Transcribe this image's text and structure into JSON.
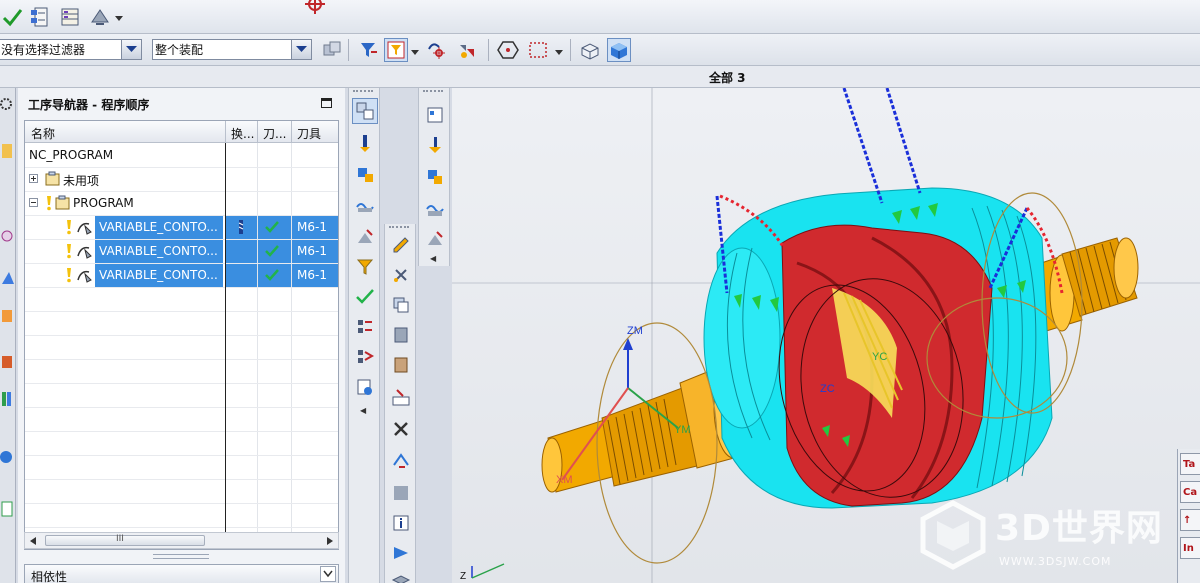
{
  "toolbar": {
    "filter_combo": "没有选择过滤器",
    "scope_combo": "整个装配"
  },
  "status_strip": {
    "text": "全部 3"
  },
  "navigator": {
    "title": "工序导航器 - 程序顺序",
    "columns": [
      "名称",
      "换...",
      "刀...",
      "刀具"
    ],
    "rows": [
      {
        "name": "NC_PROGRAM",
        "tool": ""
      },
      {
        "name": "未用项",
        "tool": ""
      },
      {
        "name": "PROGRAM",
        "tool": ""
      },
      {
        "name": "VARIABLE_CONTO...",
        "tool": "M6-1"
      },
      {
        "name": "VARIABLE_CONTO...",
        "tool": "M6-1"
      },
      {
        "name": "VARIABLE_CONTO...",
        "tool": "M6-1"
      }
    ],
    "scroll_glyph": "III",
    "dependencies_label": "相依性"
  },
  "viewport": {
    "wcs_labels": {
      "zm": "ZM",
      "zc": "ZC",
      "yc": "YC",
      "ym": "YM",
      "xm": "XM",
      "z": "Z"
    }
  },
  "right_panel": {
    "buttons": [
      "Ta",
      "Ca",
      "↑",
      "In"
    ]
  },
  "watermark": {
    "brand": "3D世界网",
    "url": "WWW.3DSJW.COM"
  },
  "colors": {
    "selection": "#3a8ee0",
    "cyan_stock": "#19e3f0",
    "part_red": "#d02a2e",
    "shaft_orange": "#f2a900"
  }
}
